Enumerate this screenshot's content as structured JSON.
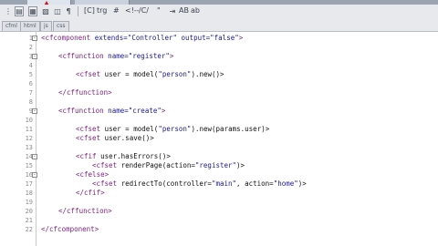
{
  "tabs": [
    "",
    ""
  ],
  "toolbar": {
    "row1": [
      "[C]",
      "trg",
      "#",
      "<!--",
      "/C/",
      "\"",
      "AB",
      "ab"
    ],
    "row2": [
      "cfml",
      "html",
      "js",
      "css"
    ]
  },
  "editor": {
    "line_numbers": [
      "1",
      "2",
      "3",
      "4",
      "5",
      "6",
      "7",
      "8",
      "9",
      "10",
      "11",
      "12",
      "13",
      "14",
      "15",
      "16",
      "17",
      "18",
      "19",
      "20",
      "21",
      "22"
    ],
    "fold_markers": [
      "-",
      "-",
      "-",
      "-",
      "-"
    ],
    "lines": {
      "l1": {
        "tag_open": "<cfcomponent",
        "a1": " extends=",
        "v1": "\"Controller\"",
        "a2": " output=",
        "v2": "\"false\"",
        "end": ">"
      },
      "l3": {
        "tag": "<cffunction",
        "a1": " name=",
        "v1": "\"register\"",
        "end": ">"
      },
      "l5": {
        "tag": "<cfset",
        "rest": " user = model(",
        "v1": "\"person\"",
        "rest2": ").new()>"
      },
      "l7": {
        "tag": "</cffunction>"
      },
      "l9": {
        "tag": "<cffunction",
        "a1": " name=",
        "v1": "\"create\"",
        "end": ">"
      },
      "l11": {
        "tag": "<cfset",
        "rest": " user = model(",
        "v1": "\"person\"",
        "rest2": ").new(params.user)>"
      },
      "l12": {
        "tag": "<cfset",
        "rest": " user.save()>"
      },
      "l14": {
        "tag": "<cfif",
        "rest": " user.hasErrors()>"
      },
      "l15": {
        "tag": "<cfset",
        "rest": " renderPage(action=",
        "v1": "\"register\"",
        "rest2": ")>"
      },
      "l16": {
        "tag": "<cfelse>"
      },
      "l17": {
        "tag": "<cfset",
        "rest": " redirectTo(controller=",
        "v1": "\"main\"",
        "rest2": ", action=",
        "v2": "\"home\"",
        "rest3": ")>"
      },
      "l18": {
        "tag": "</cfif>"
      },
      "l20": {
        "tag": "</cffunction>"
      },
      "l22": {
        "tag": "</cfcomponent>"
      }
    }
  }
}
